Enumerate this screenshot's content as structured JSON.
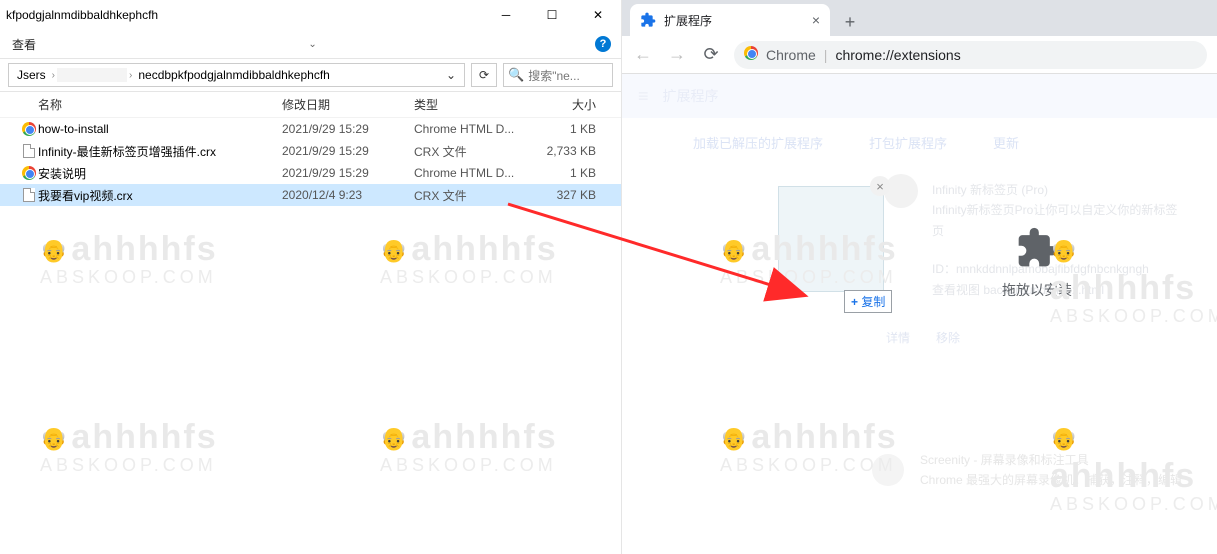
{
  "explorer": {
    "window_title": "kfpodgjalnmdibbaldhkephcfh",
    "menu_view": "查看",
    "breadcrumbs": [
      "Jsers",
      "",
      "necdbpkfpodgjalnmdibbaldhkephcfh"
    ],
    "search_placeholder": "搜索\"ne...",
    "columns": {
      "name": "名称",
      "date": "修改日期",
      "type": "类型",
      "size": "大小"
    },
    "files": [
      {
        "icon": "chrome",
        "name": "how-to-install",
        "date": "2021/9/29 15:29",
        "type": "Chrome HTML D...",
        "size": "1 KB",
        "selected": false
      },
      {
        "icon": "file",
        "name": "Infinity-最佳新标签页增强插件.crx",
        "date": "2021/9/29 15:29",
        "type": "CRX 文件",
        "size": "2,733 KB",
        "selected": false
      },
      {
        "icon": "chrome",
        "name": "安装说明",
        "date": "2021/9/29 15:29",
        "type": "Chrome HTML D...",
        "size": "1 KB",
        "selected": false
      },
      {
        "icon": "file",
        "name": "我要看vip视频.crx",
        "date": "2020/12/4 9:23",
        "type": "CRX 文件",
        "size": "327 KB",
        "selected": true
      }
    ]
  },
  "chrome": {
    "tab_title": "扩展程序",
    "omnibox_prefix": "Chrome",
    "omnibox_url": "chrome://extensions",
    "ext_header": "扩展程序",
    "btn_load_unpacked": "加载已解压的扩展程序",
    "btn_pack": "打包扩展程序",
    "btn_update": "更新",
    "card": {
      "line1": "Infinity 新标签页 (Pro)    ",
      "line2": "Infinity新标签页Pro让你可以自定义你的新标签页",
      "line3": "ID：nnnkddnnlpamobajfibfdgfnbcnkgngh",
      "line4": "查看视图  background/index.html",
      "details": "详情",
      "remove": "移除"
    },
    "copy_tip": "复制",
    "drop_label": "拖放以安装",
    "screenity": {
      "line1": "Screenity - 屏幕录像和标注工具",
      "line2": "Chrome 最强大的屏幕录像机。捕获，注释，编辑"
    }
  },
  "watermark": {
    "line1": "ahhhhfs",
    "line2": "ABSKOOP.COM"
  }
}
